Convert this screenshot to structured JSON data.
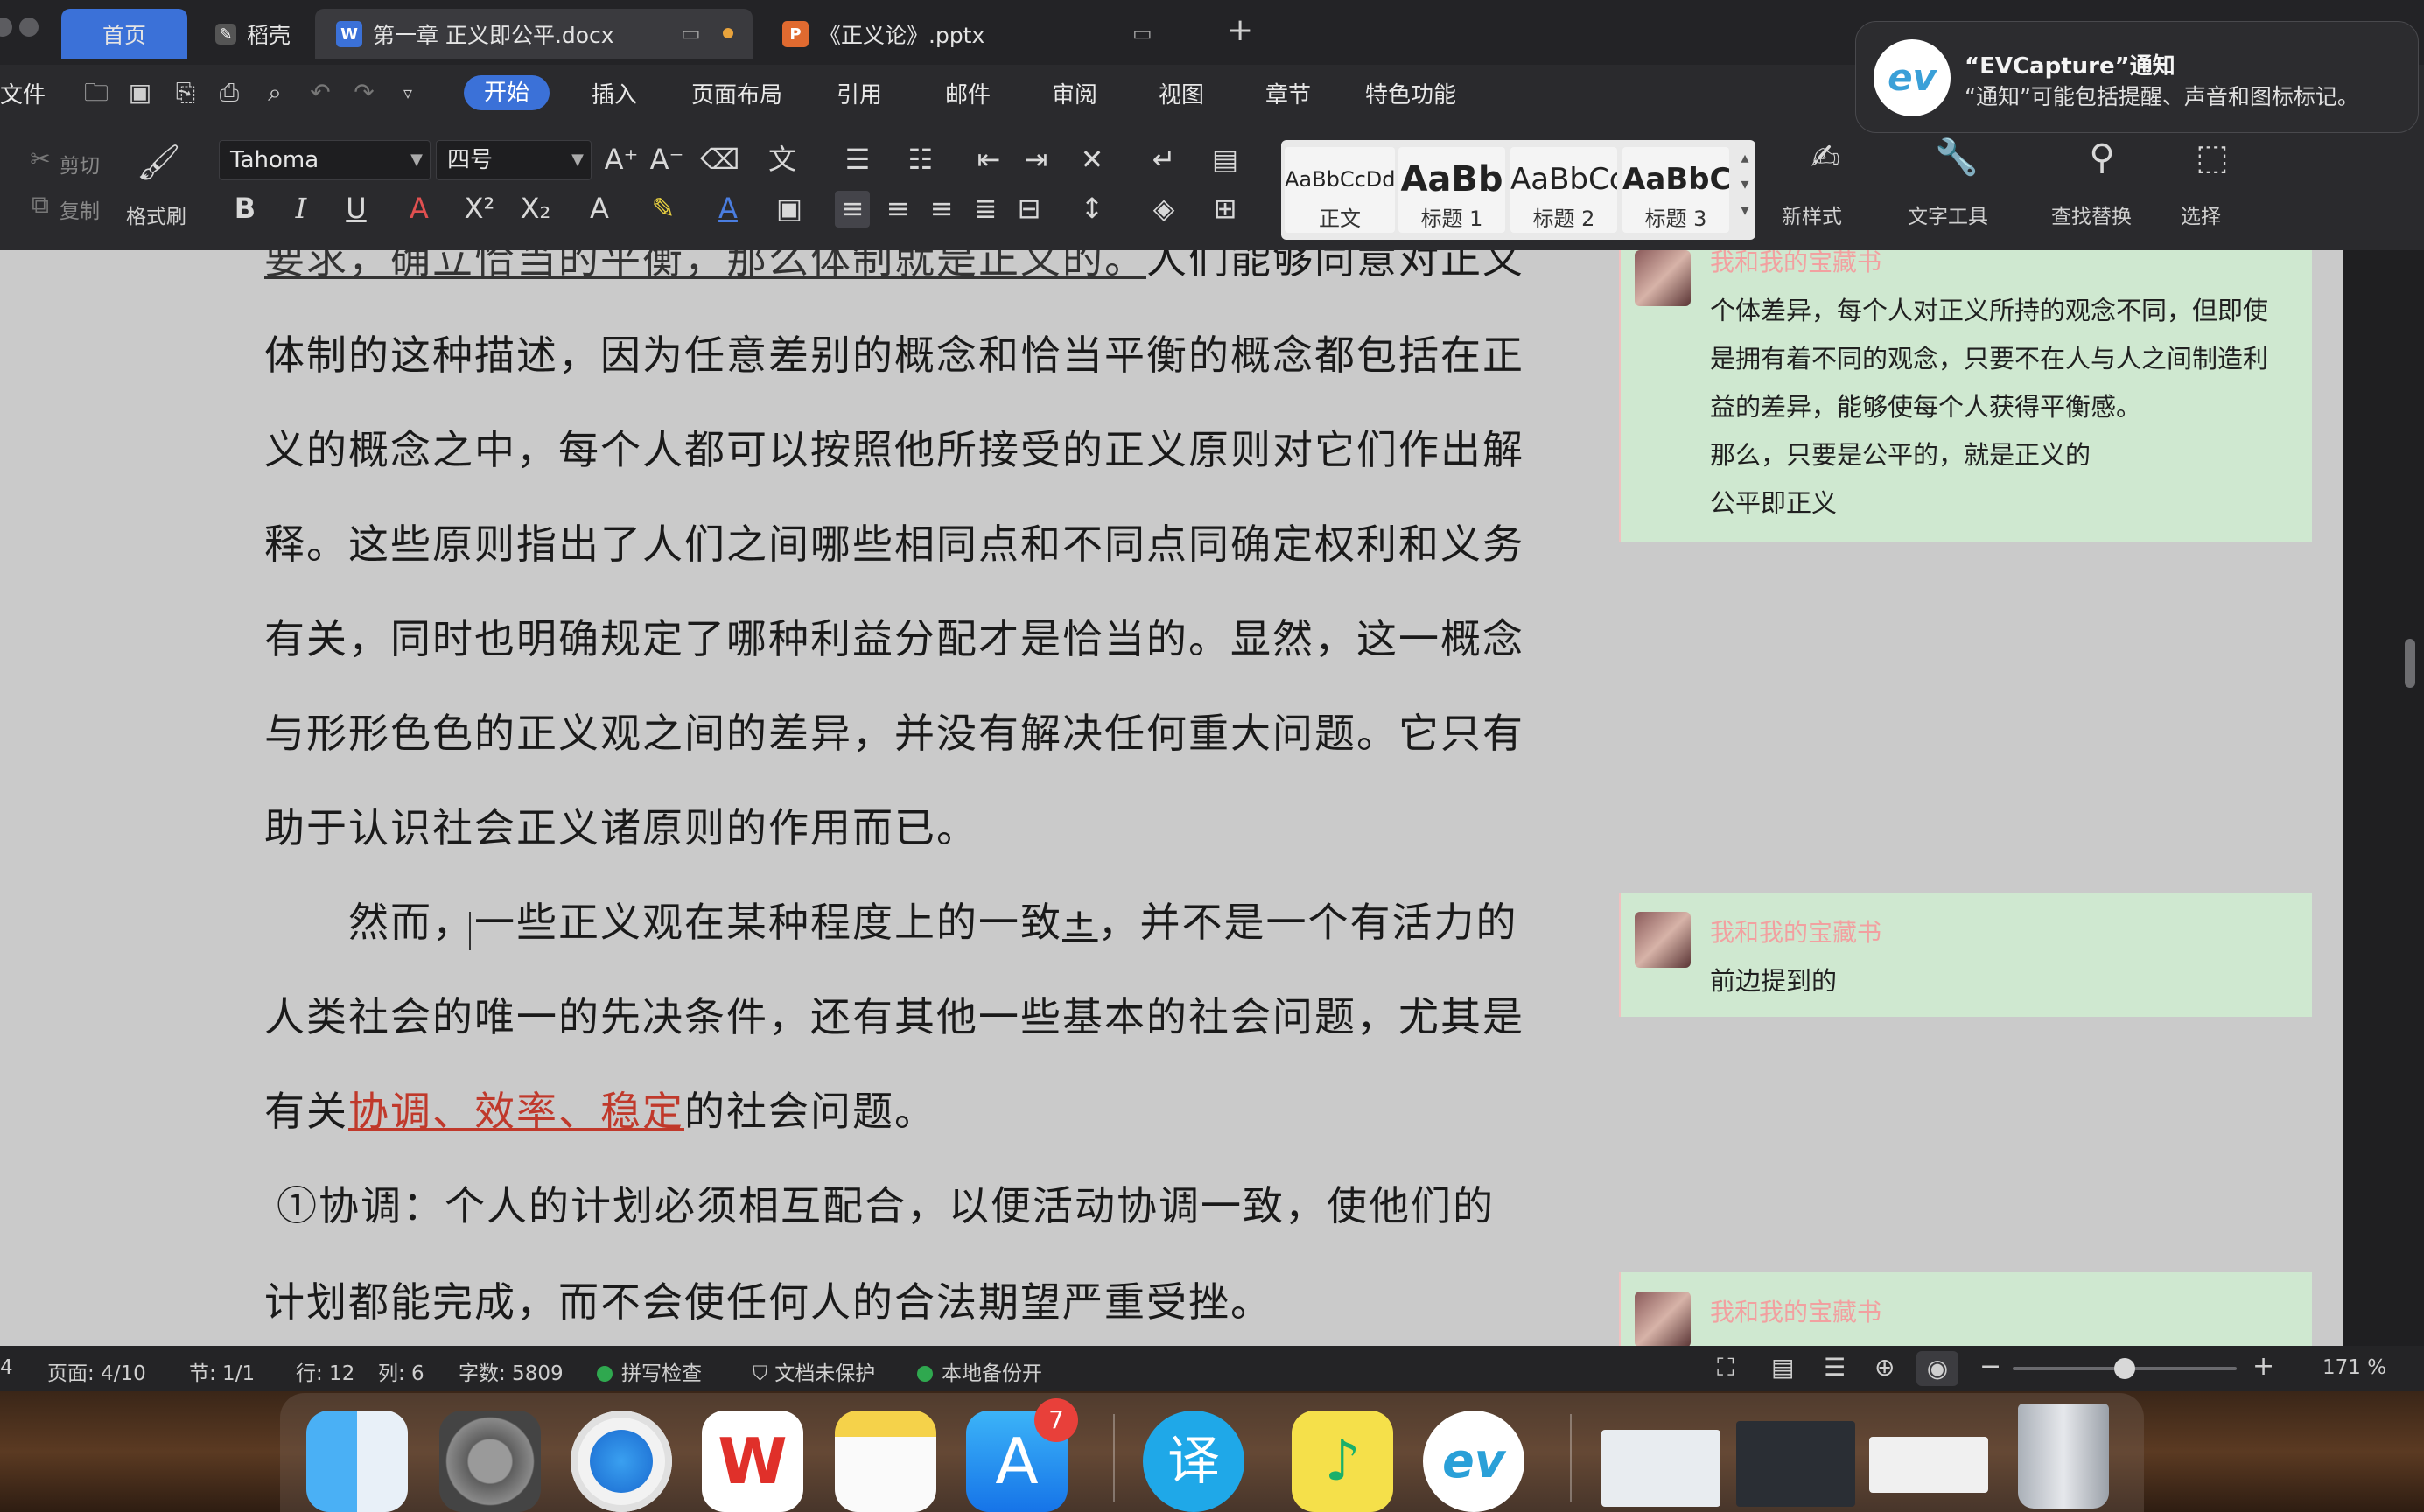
{
  "tabs": [
    {
      "label": "首页",
      "active": true
    },
    {
      "label": "稻壳"
    },
    {
      "label": "第一章 正义即公平.docx"
    },
    {
      "label": "《正义论》.pptx"
    }
  ],
  "menu": [
    "文件",
    "开始",
    "插入",
    "页面布局",
    "引用",
    "邮件",
    "审阅",
    "视图",
    "章节",
    "特色功能"
  ],
  "ribbon": {
    "cut": "剪切",
    "copy": "复制",
    "format_painter": "格式刷",
    "font_name": "Tahoma",
    "font_size": "四号",
    "styles": [
      {
        "sample": "AaBbCcDd",
        "label": "正文"
      },
      {
        "sample": "AaBb",
        "label": "标题 1"
      },
      {
        "sample": "AaBbCc",
        "label": "标题 2"
      },
      {
        "sample": "AaBbCc",
        "label": "标题 3"
      }
    ],
    "new_style": "新样式",
    "text_tools": "文字工具",
    "find_replace": "查找替换",
    "select": "选择"
  },
  "document": {
    "lines": [
      {
        "parts": [
          {
            "t": "要求，确立恰当的平衡，那么体制就是正义的。"
          },
          {
            "t": "人们能够同意对正义"
          }
        ]
      },
      {
        "parts": [
          {
            "t": "体制的这种描述，因为任意差别的概念和恰当平衡的概念都包括在正"
          }
        ]
      },
      {
        "parts": [
          {
            "t": "义的概念之中，每个人都可以按照他所接受的正义原则对它们作出解"
          }
        ]
      },
      {
        "parts": [
          {
            "t": "释。这些原则指出了人们之间哪些相同点和不同点同确定权利和义务"
          }
        ]
      },
      {
        "parts": [
          {
            "t": "有关，同时也明确规定了哪种利益分配才是恰当的。显然，这一概念"
          }
        ]
      },
      {
        "parts": [
          {
            "t": "与形形色色的正义观之间的差异，并没有解决任何重大问题。它只有"
          }
        ]
      },
      {
        "parts": [
          {
            "t": "助于认识社会正义诸原则的作用而已。"
          }
        ]
      },
      {
        "parts": [
          {
            "t": "然而，一些正义观在某种程度上的一致"
          },
          {
            "t": "±"
          },
          {
            "t": "，并不是一个有活力的"
          }
        ]
      },
      {
        "parts": [
          {
            "t": "人类社会的唯一的先决条件，还有其他一些基本的社会问题，尤其是"
          }
        ]
      },
      {
        "parts": [
          {
            "t": "有关"
          },
          {
            "t": "协调、效率、稳定"
          },
          {
            "t": "的社会问题。"
          }
        ]
      },
      {
        "parts": [
          {
            "t": "①协调：个人的计划必须相互配合，以便活动协调一致，使他们的"
          }
        ]
      },
      {
        "parts": [
          {
            "t": "计划都能完成，而不会使任何人的合法期望严重受挫。"
          }
        ]
      }
    ]
  },
  "comments": [
    {
      "author": "我和我的宝藏书",
      "lines": [
        "个体差异，每个人对正义所持的观念不同，但即使",
        "是拥有着不同的观念，只要不在人与人之间制造利",
        "益的差异，能够使每个人获得平衡感。",
        "那么，只要是公平的，就是正义的",
        "公平即正义"
      ]
    },
    {
      "author": "我和我的宝藏书",
      "lines": [
        "前边提到的"
      ]
    },
    {
      "author": "我和我的宝藏书",
      "lines": []
    }
  ],
  "status": {
    "page_num": "4",
    "page": "页面: 4/10",
    "section": "节: 1/1",
    "row": "行: 12",
    "col": "列: 6",
    "words": "字数: 5809",
    "spell": "拼写检查",
    "protect": "文档未保护",
    "backup": "本地备份开",
    "zoom": "171 %",
    "zoom_level": 0.5
  },
  "notification": {
    "title": "“EVCapture”通知",
    "body": "“通知”可能包括提醒、声音和图标标记。"
  },
  "dock": {
    "badge": "7",
    "apps": [
      "finder-icon",
      "settings-icon",
      "safari-icon",
      "wps-icon",
      "notes-icon",
      "app-store-icon",
      "translate-icon",
      "music-icon",
      "evcapture-icon",
      "window-thumbnail-1",
      "window-thumbnail-2",
      "window-thumbnail-3",
      "trash-icon"
    ]
  },
  "colors": {
    "accent": "#3b71d8",
    "comment_bg": "#cfe8d0",
    "track_red": "#c0392b",
    "page_bg": "#cacaca"
  }
}
